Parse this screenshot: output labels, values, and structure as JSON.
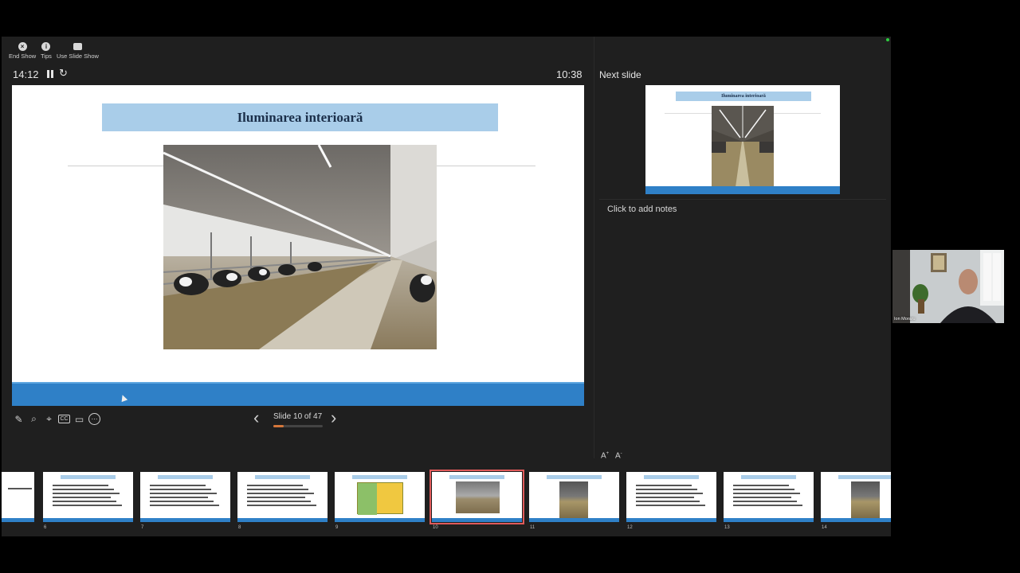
{
  "toolbar": {
    "end_show": "End Show",
    "tips": "Tips",
    "use_slide_show": "Use Slide Show"
  },
  "presenter": {
    "elapsed_time": "14:12",
    "clock": "10:38"
  },
  "current_slide": {
    "title": "Iluminarea interioară"
  },
  "navigation": {
    "slide_counter": "Slide 10 of 47",
    "progress": 0.21
  },
  "next_slide": {
    "label": "Next slide",
    "title": "Iluminarea interioară"
  },
  "notes": {
    "placeholder": "Click to add notes"
  },
  "thumbnails": [
    {
      "num": "",
      "kind": "partial"
    },
    {
      "num": "6",
      "kind": "text"
    },
    {
      "num": "7",
      "kind": "text"
    },
    {
      "num": "8",
      "kind": "text"
    },
    {
      "num": "9",
      "kind": "table"
    },
    {
      "num": "10",
      "kind": "photo",
      "current": true
    },
    {
      "num": "11",
      "kind": "photo"
    },
    {
      "num": "12",
      "kind": "text"
    },
    {
      "num": "13",
      "kind": "text"
    },
    {
      "num": "14",
      "kind": "photo"
    }
  ],
  "webcam": {
    "participant_name": "Ion Moraru"
  },
  "colors": {
    "title_bar": "#a9cde9",
    "footer_bar": "#2f80c7",
    "current_outline": "#e05a5a",
    "progress": "#d4763a"
  }
}
